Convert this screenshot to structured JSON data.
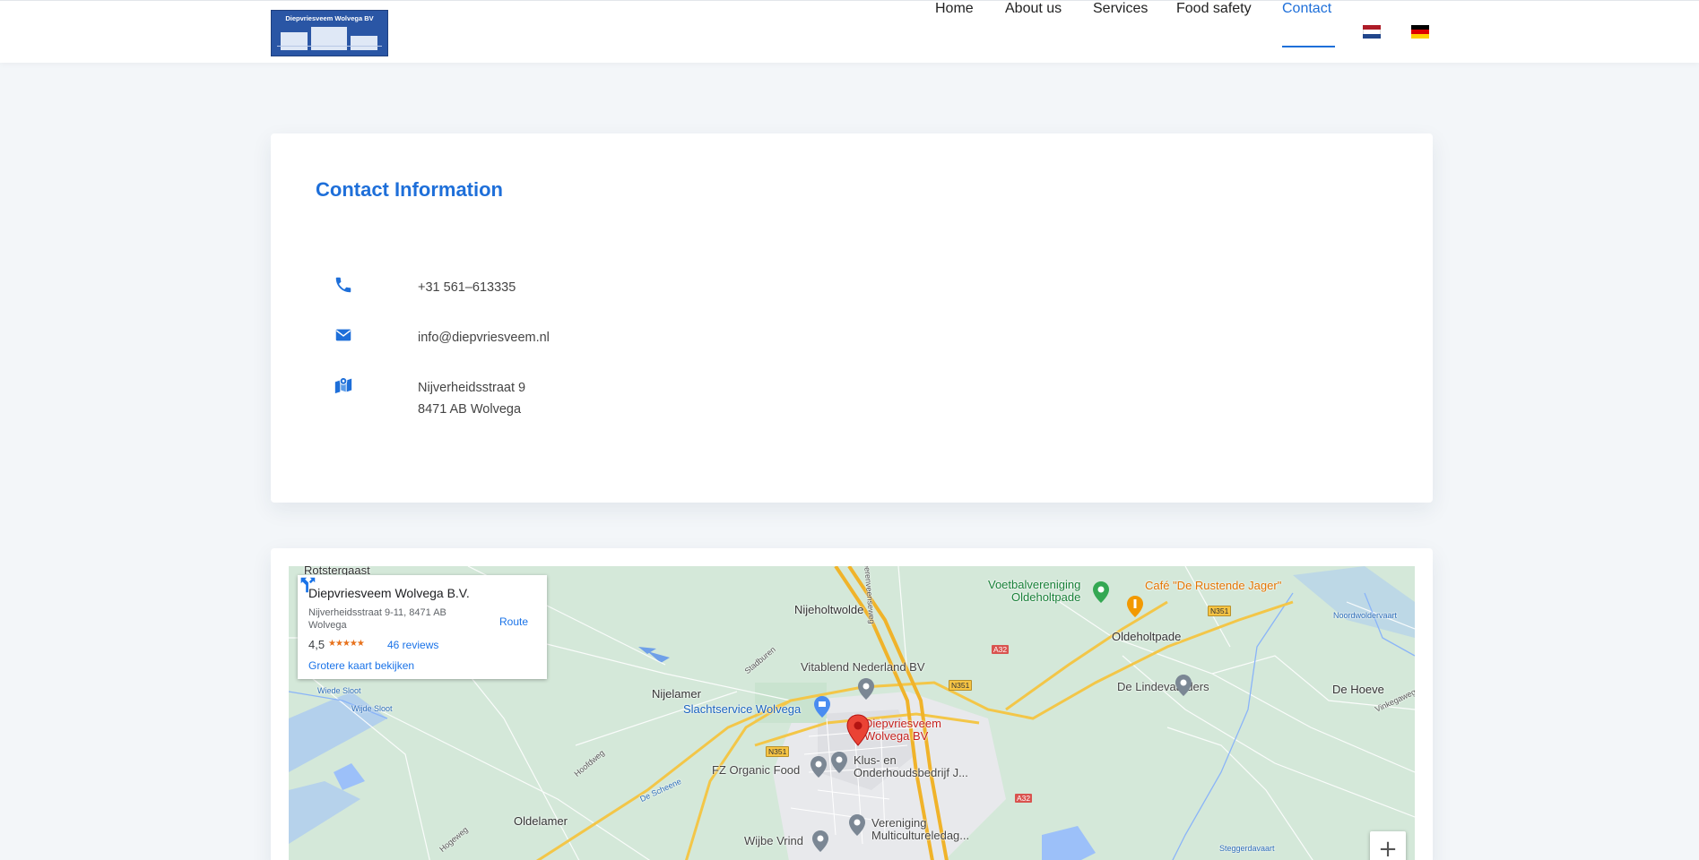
{
  "header": {
    "logo_text": "Diepvriesveem Wolvega BV",
    "nav": [
      {
        "label": "Home"
      },
      {
        "label": "About us"
      },
      {
        "label": "Services"
      },
      {
        "label": "Food safety"
      },
      {
        "label": "Contact",
        "active": true
      }
    ],
    "flags": [
      "netherlands-flag",
      "germany-flag"
    ]
  },
  "contact": {
    "title": "Contact Information",
    "phone": "+31 561–613335",
    "email": "info@diepvriesveem.nl",
    "address_line1": "Nijverheidsstraat 9",
    "address_line2": "8471 AB Wolvega"
  },
  "map": {
    "place_name": "Diepvriesveem Wolvega B.V.",
    "place_address": "Nijverheidsstraat 9-11, 8471 AB Wolvega",
    "rating": "4,5",
    "stars": "★★★★★",
    "reviews": "46 reviews",
    "larger_map": "Grotere kaart bekijken",
    "route": "Route",
    "zoom_in": "+",
    "labels": {
      "rotstergaast": "Rotstergaast",
      "nijeholtwolde": "Nijeholtwolde",
      "nijelamer": "Nijelamer",
      "oldelamer": "Oldelamer",
      "oldeholtpade": "Oldeholtpade",
      "de_hoeve": "De Hoeve",
      "de_lindevaarders": "De Lindevaarders",
      "vitablend": "Vitablend Nederland BV",
      "slachtservice": "Slachtservice Wolvega",
      "marker_line1": "Diepvriesveem",
      "marker_line2": "Wolvega BV",
      "fz_organic": "FZ Organic Food",
      "klus_line1": "Klus- en",
      "klus_line2": "Onderhoudsbedrijf J...",
      "wijbe": "Wijbe Vrind",
      "vereniging_line1": "Vereniging",
      "vereniging_line2": "Multicultureledag...",
      "voetbal_line1": "Voetbalvereniging",
      "voetbal_line2": "Oldeholtpade",
      "cafe": "Café \"De Rustende Jager\"",
      "wiede_sloot": "Wiede Sloot",
      "wijde_sloot": "Wijde Sloot",
      "de_scheene": "De Scheene",
      "hoofdweg": "Hoofdweg",
      "stadburen": "Stadburen",
      "heerenveenseweg": "Heerenveenseweg",
      "hogeweg": "Hogeweg",
      "noordwoldervaart": "Noordwoldervaart",
      "steggerdavaart": "Steggerdavaart",
      "vinkegaweg": "Vinkegaweg",
      "a32_top": "A32",
      "a32_bottom": "A32",
      "n351_a": "N351",
      "n351_b": "N351",
      "n351_c": "N351"
    }
  },
  "colors": {
    "accent": "#1e6fd9",
    "marker": "#ea4335",
    "map_land": "#d4e8d9"
  }
}
